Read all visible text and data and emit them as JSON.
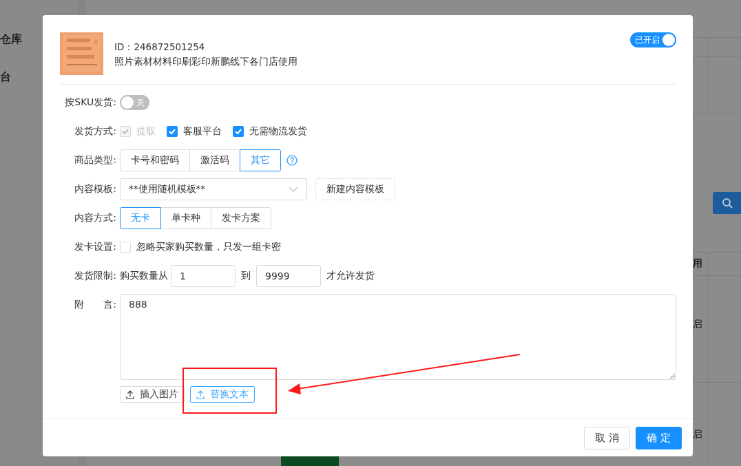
{
  "background": {
    "sidebar_items": [
      "仓库",
      "台"
    ],
    "column_header": "用",
    "cells": [
      "启",
      "启"
    ]
  },
  "modal": {
    "product": {
      "id": "ID：246872501254",
      "title": "照片素材材料印刷彩印新鹏线下各门店使用"
    },
    "status_toggle": {
      "label": "已开启",
      "on": true
    },
    "fields": [
      {
        "kind": "toggle",
        "label": "按SKU发货:",
        "on": false,
        "text": "关"
      },
      {
        "kind": "checkboxes",
        "label": "发货方式:",
        "options": [
          {
            "label": "提取",
            "checked": true,
            "disabled": true
          },
          {
            "label": "客服平台",
            "checked": true,
            "disabled": false
          },
          {
            "label": "无需物流发货",
            "checked": true,
            "disabled": false
          }
        ]
      },
      {
        "kind": "segmented",
        "label": "商品类型:",
        "help_icon": true,
        "options": [
          {
            "label": "卡号和密码",
            "selected": false
          },
          {
            "label": "激活码",
            "selected": false
          },
          {
            "label": "其它",
            "selected": true
          }
        ]
      },
      {
        "kind": "select",
        "label": "内容模板:",
        "value": "**使用随机模板**",
        "action": "新建内容模板"
      },
      {
        "kind": "segmented",
        "label": "内容方式:",
        "help_icon": false,
        "options": [
          {
            "label": "无卡",
            "selected": true
          },
          {
            "label": "单卡种",
            "selected": false
          },
          {
            "label": "发卡方案",
            "selected": false
          }
        ]
      },
      {
        "kind": "checkbox",
        "label": "发卡设置:",
        "text": "忽略买家购买数量，只发一组卡密",
        "checked": false
      },
      {
        "kind": "range",
        "label": "发货限制:",
        "prefix": "购买数量从",
        "from": "1",
        "middle": "到",
        "to": "9999",
        "suffix": "才允许发货"
      },
      {
        "kind": "textarea",
        "label": "附　　言:",
        "value": "888",
        "buttons": [
          {
            "label": "插入图片",
            "highlighted": false
          },
          {
            "label": "替换文本",
            "highlighted": true
          }
        ]
      }
    ],
    "footer_buttons": [
      {
        "label": "取 消",
        "primary": false
      },
      {
        "label": "确 定",
        "primary": true
      }
    ]
  }
}
